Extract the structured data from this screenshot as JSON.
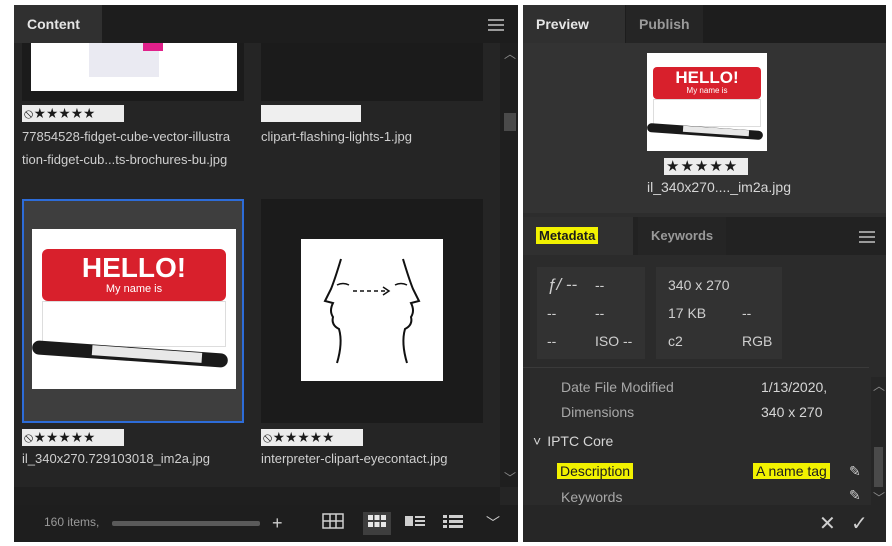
{
  "content_panel": {
    "tab": "Content",
    "items": [
      {
        "rating": "⦸★★★★★",
        "line1": "77854528-fidget-cube-vector-illustra",
        "line2": "tion-fidget-cub...ts-brochures-bu.jpg"
      },
      {
        "rating": "",
        "line1": "clipart-flashing-lights-1.jpg",
        "line2": ""
      },
      {
        "rating": "⦸★★★★★",
        "line1": "il_340x270.729103018_im2a.jpg",
        "line2": "",
        "hello": "HELLO!",
        "my_name": "My name is"
      },
      {
        "rating": "⦸★★★★★",
        "line1": "interpreter-clipart-eyecontact.jpg",
        "line2": ""
      }
    ],
    "footer": {
      "count": "160 items,"
    }
  },
  "right_tabs": {
    "preview": "Preview",
    "publish": "Publish"
  },
  "preview": {
    "hello": "HELLO!",
    "my_name": "My name is",
    "rating": "★★★★★",
    "filename": "il_340x270...._im2a.jpg"
  },
  "metadata_tabs": {
    "metadata": "Metadata",
    "keywords": "Keywords"
  },
  "camera": {
    "fstop": "ƒ/ --",
    "fval": "--",
    "r2a": "--",
    "r2b": "--",
    "r3a": "--",
    "iso": "ISO --",
    "dims": "340 x 270",
    "size": "17 KB",
    "size_x": "--",
    "cs": "c2",
    "mode": "RGB"
  },
  "fields": {
    "date_label": "Date File Modified",
    "date_value": "1/13/2020,",
    "dim_label": "Dimensions",
    "dim_value": "340 x 270",
    "section": "IPTC Core",
    "desc_label": "Description",
    "desc_value": "A name tag",
    "kw_label": "Keywords"
  },
  "colors": {
    "accent_blue": "#2d6cd8",
    "highlight": "#f2f200",
    "hello_red": "#d8202c"
  }
}
